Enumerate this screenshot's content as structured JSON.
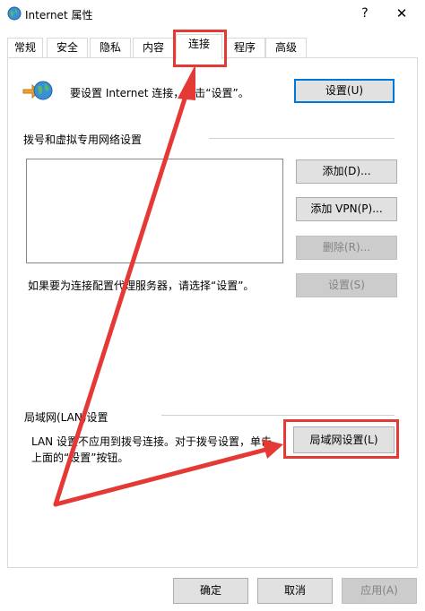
{
  "window": {
    "title": "Internet 属性",
    "help": "?",
    "close": "✕"
  },
  "tabs": [
    "常规",
    "安全",
    "隐私",
    "内容",
    "连接",
    "程序",
    "高级"
  ],
  "active_tab": "连接",
  "setup": {
    "text": "要设置 Internet 连接，单击“设置”。",
    "button": "设置(U)"
  },
  "dialup": {
    "header": "拨号和虚拟专用网络设置",
    "add": "添加(D)...",
    "add_vpn": "添加 VPN(P)...",
    "remove": "删除(R)...",
    "hint": "如果要为连接配置代理服务器，请选择“设置”。",
    "settings": "设置(S)"
  },
  "lan": {
    "header": "局域网(LAN)设置",
    "text_line1": "LAN 设置不应用到拨号连接。对于拨号设置，单击",
    "text_line2": "上面的“设置”按钮。",
    "button": "局域网设置(L)"
  },
  "footer": {
    "ok": "确定",
    "cancel": "取消",
    "apply": "应用(A)"
  },
  "colors": {
    "highlight": "#e53935",
    "accent": "#0078d7"
  },
  "icons": {
    "app": "globe-icon",
    "setup": "globe-connect-icon"
  }
}
